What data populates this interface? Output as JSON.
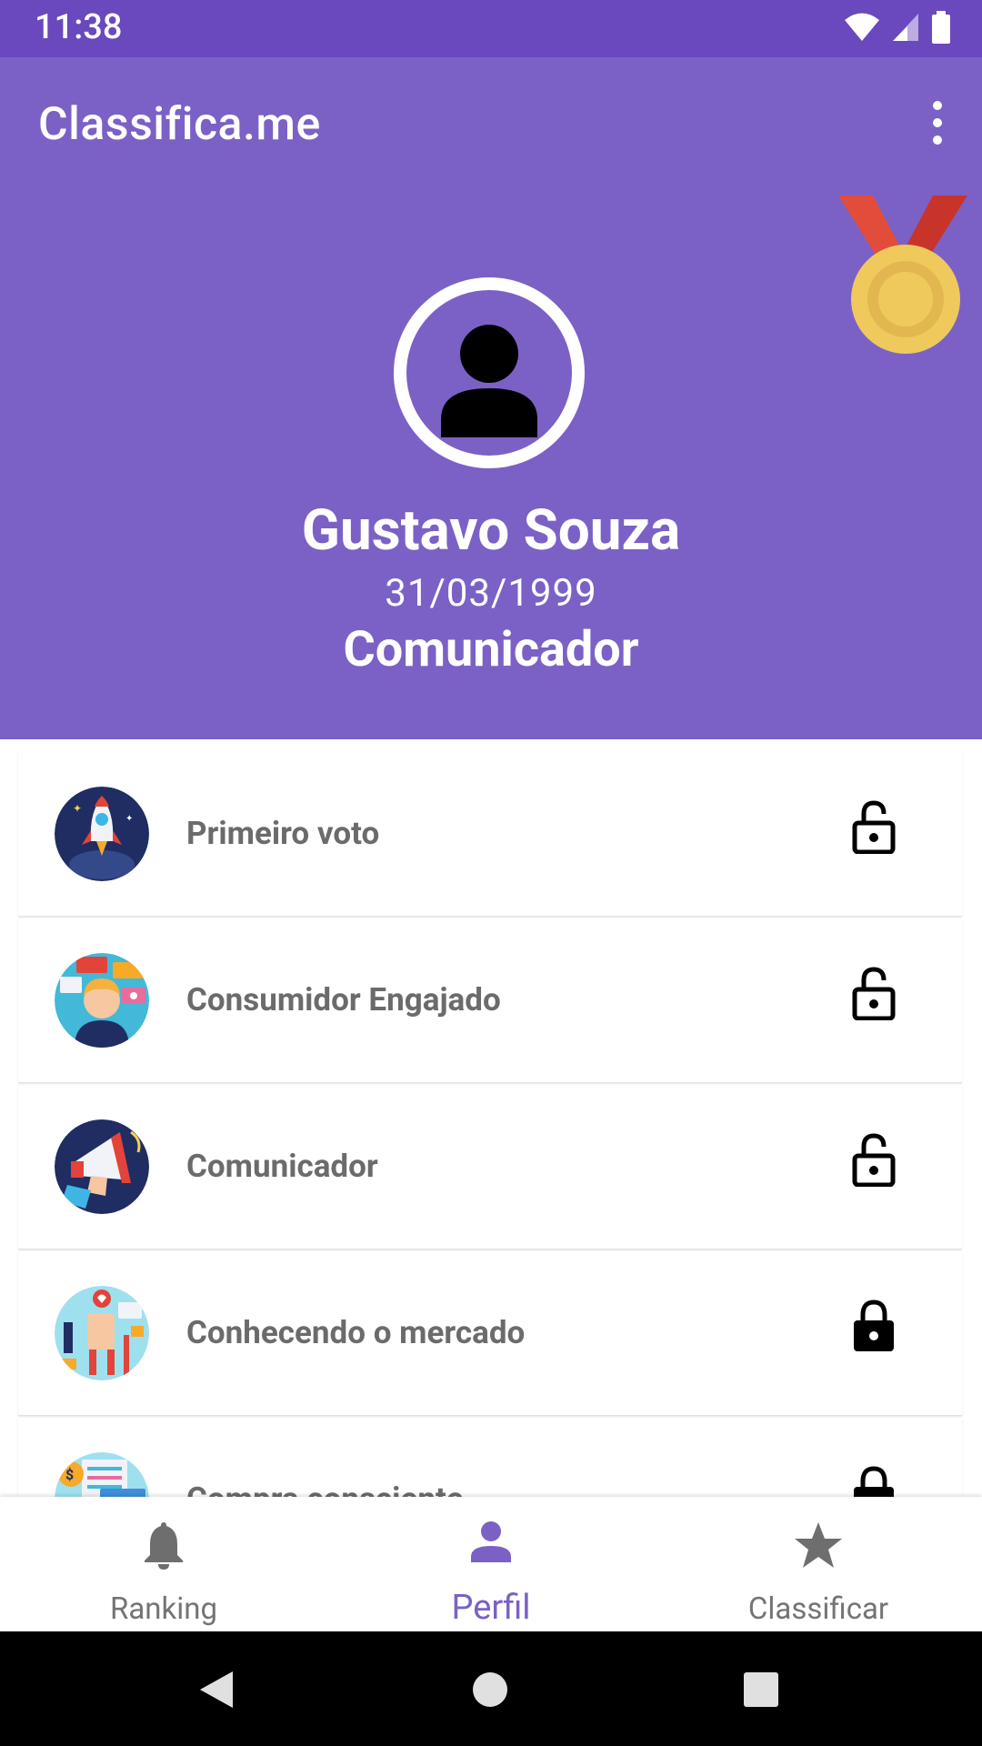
{
  "status_bar": {
    "time": "11:38"
  },
  "app": {
    "title": "Classifica.me",
    "accent_color": "#7b61c6",
    "status_color": "#6a48bd"
  },
  "profile": {
    "name": "Gustavo Souza",
    "birth_date": "31/03/1999",
    "title": "Comunicador"
  },
  "achievements": [
    {
      "label": "Primeiro voto",
      "icon": "rocket-icon",
      "locked": false
    },
    {
      "label": "Consumidor Engajado",
      "icon": "reviewer-icon",
      "locked": false
    },
    {
      "label": "Comunicador",
      "icon": "megaphone-icon",
      "locked": false
    },
    {
      "label": "Conhecendo o mercado",
      "icon": "market-icon",
      "locked": true
    },
    {
      "label": "Compra consciente",
      "icon": "conscious-purchase-icon",
      "locked": true
    }
  ],
  "bottom_nav": [
    {
      "label": "Ranking",
      "icon": "bell-icon",
      "active": false
    },
    {
      "label": "Perfil",
      "icon": "person-icon",
      "active": true
    },
    {
      "label": "Classificar",
      "icon": "star-icon",
      "active": false
    }
  ]
}
